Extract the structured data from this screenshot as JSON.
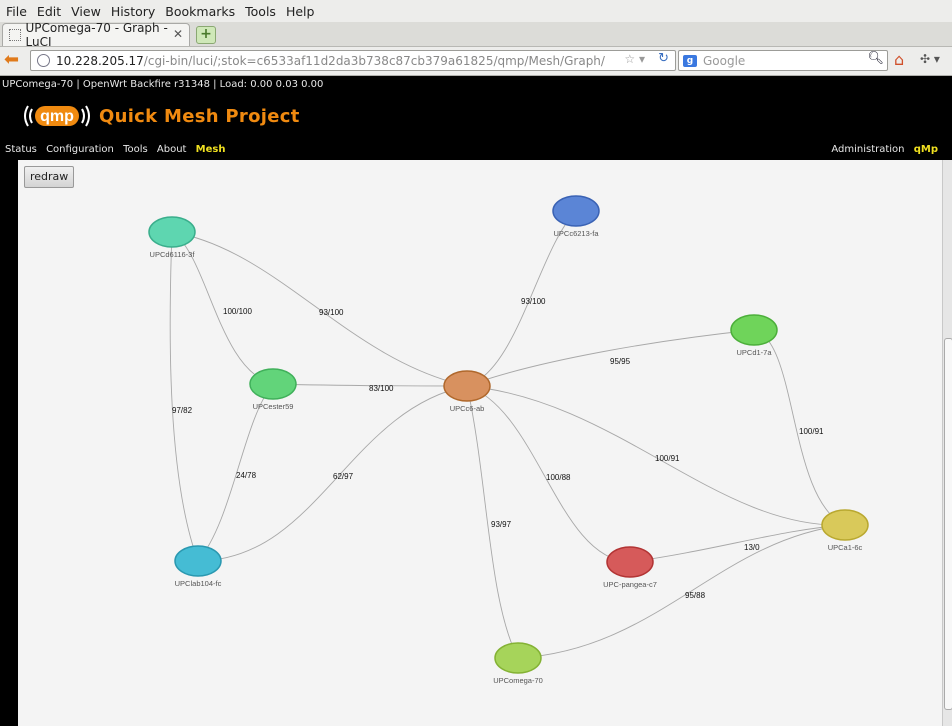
{
  "browser": {
    "menu": [
      "File",
      "Edit",
      "View",
      "History",
      "Bookmarks",
      "Tools",
      "Help"
    ],
    "tab_title": "UPComega-70 - Graph - LuCI",
    "url_host": "10.228.205.17",
    "url_path": "/cgi-bin/luci/;stok=c6533af11d2da3b738c87cb379a61825/qmp/Mesh/Graph/",
    "search_placeholder": "Google"
  },
  "page": {
    "status_line": "UPComega-70 | OpenWrt Backfire r31348 | Load: 0.00 0.03 0.00",
    "logo_text": "qmp",
    "brand": "Quick Mesh Project",
    "nav": [
      "Status",
      "Configuration",
      "Tools",
      "About",
      "Mesh"
    ],
    "nav_active": "Mesh",
    "right_nav": [
      "Administration",
      "qMp"
    ],
    "redraw_label": "redraw"
  },
  "graph": {
    "nodes": [
      {
        "id": "UPCd6116-3f",
        "color": "#5ed6b0",
        "stroke": "#3aae8c"
      },
      {
        "id": "UPCc6213-fa",
        "color": "#5b85d6",
        "stroke": "#3a62b4"
      },
      {
        "id": "UPCd1-7a",
        "color": "#6fd45a",
        "stroke": "#4caf3a"
      },
      {
        "id": "UPCester59",
        "color": "#62d47a",
        "stroke": "#40b05a"
      },
      {
        "id": "UPCc6-ab",
        "color": "#d8915f",
        "stroke": "#b0682c"
      },
      {
        "id": "UPCa1-6c",
        "color": "#d9c95a",
        "stroke": "#b9a830"
      },
      {
        "id": "UPC-pangea-c7",
        "color": "#d65a5a",
        "stroke": "#b23434"
      },
      {
        "id": "UPClab104-fc",
        "color": "#45bcd4",
        "stroke": "#2a98b0"
      },
      {
        "id": "UPComega-70",
        "color": "#a6d45a",
        "stroke": "#84b234"
      }
    ],
    "links": [
      {
        "source": "UPCd6116-3f",
        "target": "UPCester59",
        "label": "100/100"
      },
      {
        "source": "UPCd6116-3f",
        "target": "UPCc6-ab",
        "label": "93/100"
      },
      {
        "source": "UPCd6116-3f",
        "target": "UPClab104-fc",
        "label": "97/82"
      },
      {
        "source": "UPCc6213-fa",
        "target": "UPCc6-ab",
        "label": "93/100"
      },
      {
        "source": "UPCester59",
        "target": "UPCc6-ab",
        "label": "83/100"
      },
      {
        "source": "UPCester59",
        "target": "UPClab104-fc",
        "label": "24/78"
      },
      {
        "source": "UPClab104-fc",
        "target": "UPCc6-ab",
        "label": "62/97"
      },
      {
        "source": "UPCd1-7a",
        "target": "UPCc6-ab",
        "label": "95/95"
      },
      {
        "source": "UPCd1-7a",
        "target": "UPCa1-6c",
        "label": "100/91"
      },
      {
        "source": "UPCc6-ab",
        "target": "UPCa1-6c",
        "label": "100/91"
      },
      {
        "source": "UPCc6-ab",
        "target": "UPC-pangea-c7",
        "label": "100/88"
      },
      {
        "source": "UPCc6-ab",
        "target": "UPComega-70",
        "label": "93/97"
      },
      {
        "source": "UPC-pangea-c7",
        "target": "UPCa1-6c",
        "label": "13/0"
      },
      {
        "source": "UPComega-70",
        "target": "UPCa1-6c",
        "label": "95/88"
      }
    ]
  }
}
